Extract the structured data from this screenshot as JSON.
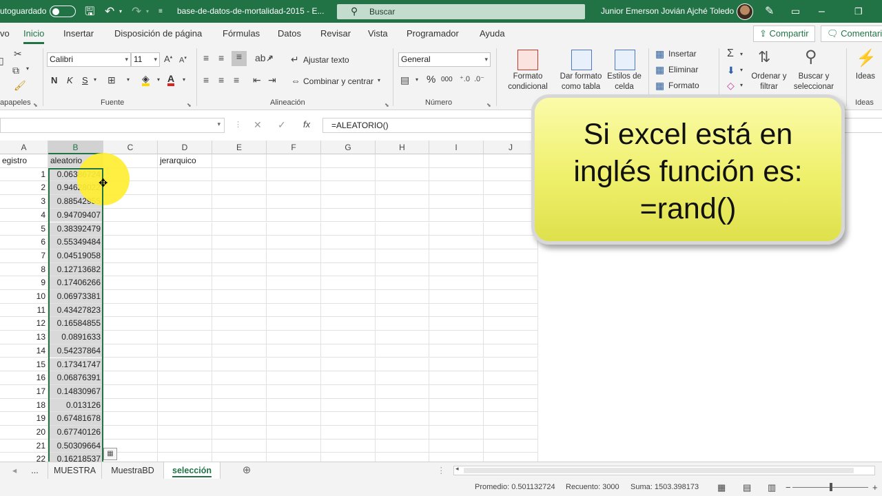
{
  "titlebar": {
    "autosave_label": "utoguardado",
    "doc_title": "base-de-datos-de-mortalidad-2015 - E...",
    "search_placeholder": "Buscar",
    "user_name": "Junior Emerson Jovián Ajché Toledo"
  },
  "tabs": [
    "vo",
    "Inicio",
    "Insertar",
    "Disposición de página",
    "Fórmulas",
    "Datos",
    "Revisar",
    "Vista",
    "Programador",
    "Ayuda"
  ],
  "active_tab": "Inicio",
  "share_label": "Compartir",
  "comments_label": "Comentari",
  "ribbon": {
    "clipboard_label": "apapeles",
    "font_name": "Calibri",
    "font_size": "11",
    "font_group_label": "Fuente",
    "bold": "N",
    "italic": "K",
    "underline": "S",
    "wrap_text": "Ajustar texto",
    "merge_center": "Combinar y centrar",
    "alignment_label": "Alineación",
    "number_format": "General",
    "percent": "%",
    "thousands": "000",
    "number_label": "Número",
    "conditional_format": [
      "Formato",
      "condicional"
    ],
    "format_as_table": [
      "Dar formato",
      "como tabla"
    ],
    "cell_styles": [
      "Estilos de",
      "celda"
    ],
    "insert": "Insertar",
    "delete": "Eliminar",
    "format": "Formato",
    "sort_filter": [
      "Ordenar y",
      "filtrar"
    ],
    "find_select": [
      "Buscar y",
      "seleccionar"
    ],
    "ideas": "Ideas",
    "ideas_group": "Ideas"
  },
  "formula_bar": {
    "fx": "fx",
    "formula": "=ALEATORIO()"
  },
  "columns": [
    "A",
    "B",
    "C",
    "D",
    "E",
    "F",
    "G",
    "H",
    "I",
    "J"
  ],
  "header_row": {
    "A": "egistro",
    "B": "aleatorio",
    "D": "jerarquico"
  },
  "rows": [
    {
      "a": "1",
      "b": "0.06386724"
    },
    {
      "a": "2",
      "b": "0.94628022"
    },
    {
      "a": "3",
      "b": "0.88542955"
    },
    {
      "a": "4",
      "b": "0.94709407"
    },
    {
      "a": "5",
      "b": "0.38392479"
    },
    {
      "a": "6",
      "b": "0.55349484"
    },
    {
      "a": "7",
      "b": "0.04519058"
    },
    {
      "a": "8",
      "b": "0.12713682"
    },
    {
      "a": "9",
      "b": "0.17406266"
    },
    {
      "a": "10",
      "b": "0.06973381"
    },
    {
      "a": "11",
      "b": "0.43427823"
    },
    {
      "a": "12",
      "b": "0.16584855"
    },
    {
      "a": "13",
      "b": "0.0891633"
    },
    {
      "a": "14",
      "b": "0.54237864"
    },
    {
      "a": "15",
      "b": "0.17341747"
    },
    {
      "a": "16",
      "b": "0.06876391"
    },
    {
      "a": "17",
      "b": "0.14830967"
    },
    {
      "a": "18",
      "b": "0.013126"
    },
    {
      "a": "19",
      "b": "0.67481678"
    },
    {
      "a": "20",
      "b": "0.67740126"
    },
    {
      "a": "21",
      "b": "0.50309664"
    },
    {
      "a": "22",
      "b": "0.16218537"
    }
  ],
  "callout": {
    "lines": [
      "Si excel está en",
      "inglés función es:",
      "=rand()"
    ]
  },
  "sheets": {
    "ellipsis": "...",
    "tabs": [
      "MUESTRA",
      "MuestraBD",
      "selección"
    ],
    "active": "selección"
  },
  "status": {
    "average": "Promedio: 0.501132724",
    "count": "Recuento: 3000",
    "sum": "Suma: 1503.398173"
  },
  "colors": {
    "excel_green": "#217346",
    "callout_yellow": "#eff06b",
    "highlight": "#ffee33"
  }
}
